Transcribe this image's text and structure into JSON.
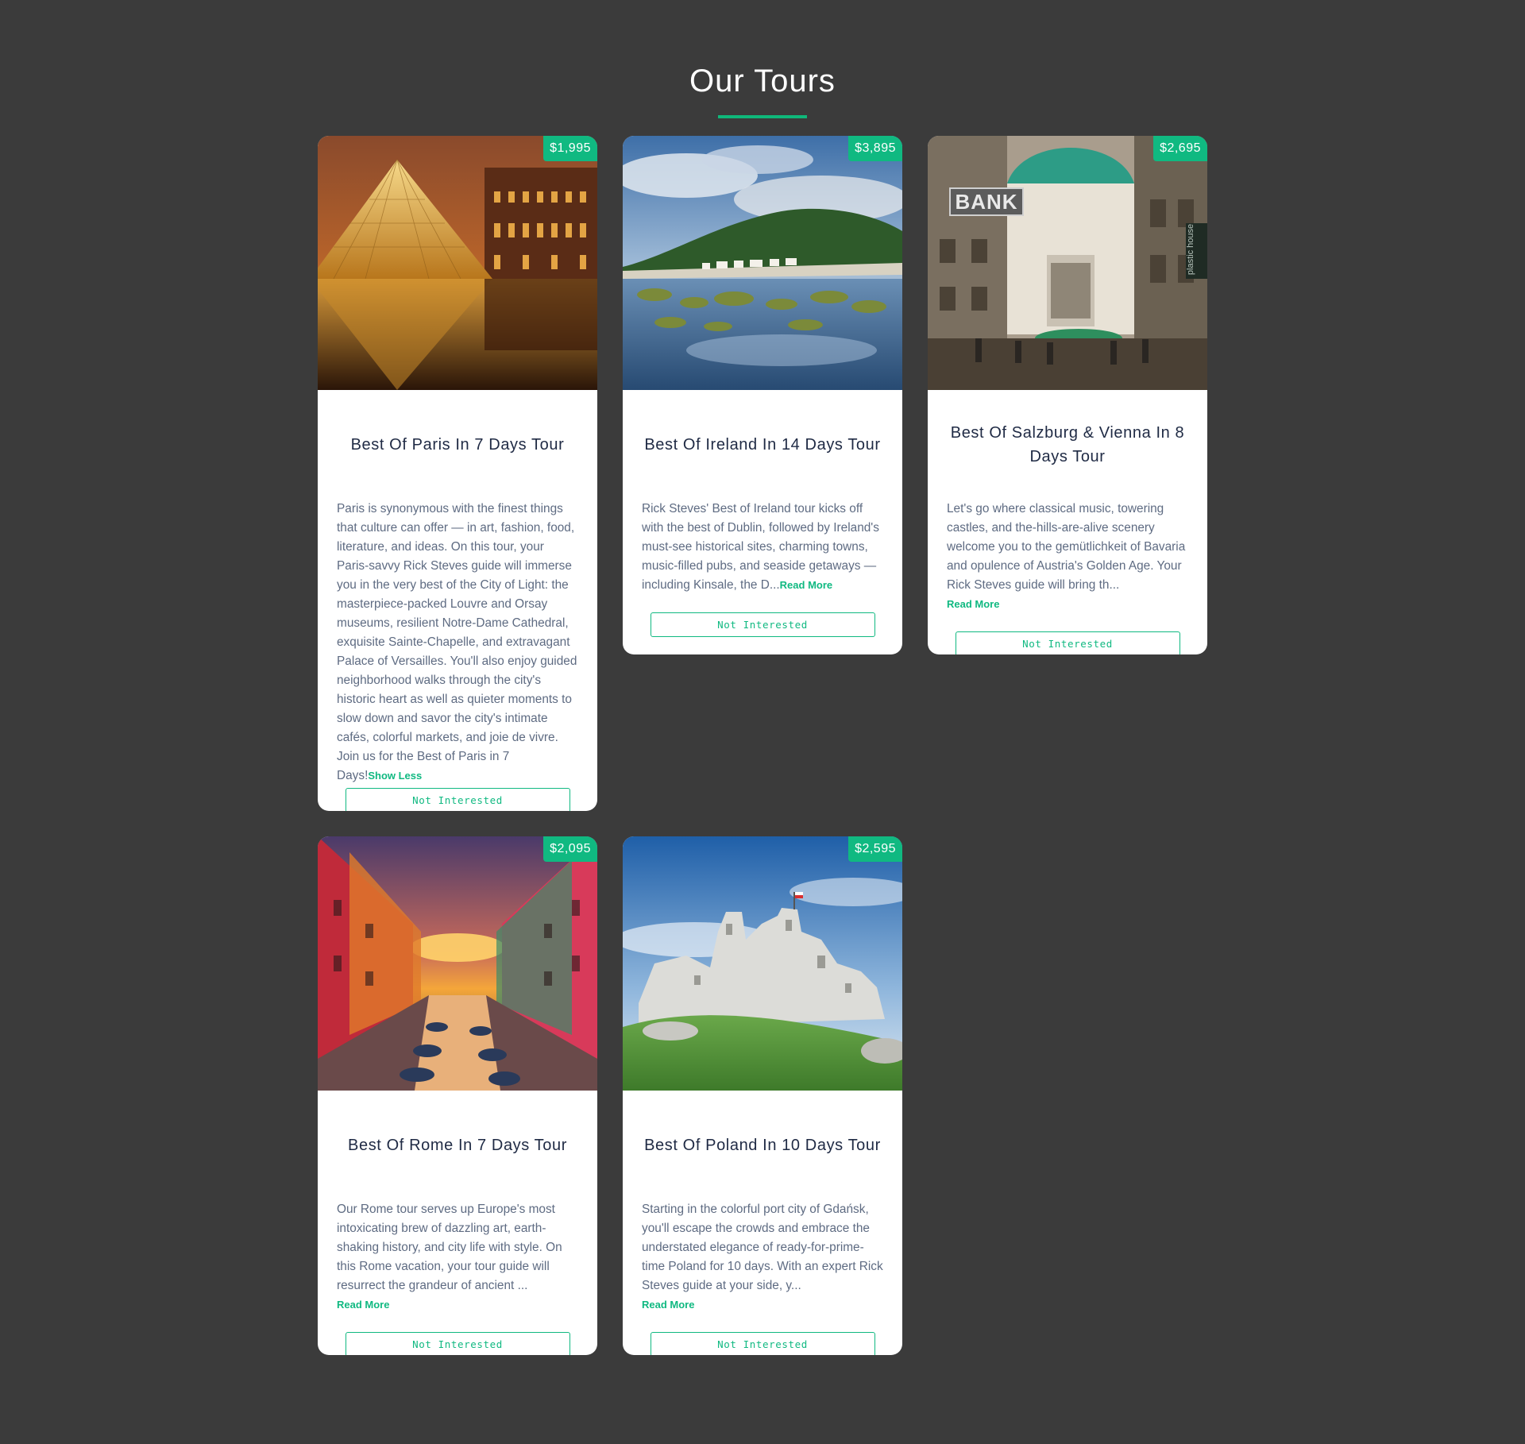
{
  "page": {
    "title": "Our Tours",
    "colors": {
      "background": "#3b3b3b",
      "accent": "#10b981",
      "card": "#ffffff"
    }
  },
  "tours": [
    {
      "price": "$1,995",
      "name": "Best Of Paris In 7 Days Tour",
      "description": "Paris is synonymous with the finest things that culture can offer — in art, fashion, food, literature, and ideas. On this tour, your Paris-savvy Rick Steves guide will immerse you in the very best of the City of Light: the masterpiece-packed Louvre and Orsay museums, resilient Notre-Dame Cathedral, exquisite Sainte-Chapelle, and extravagant Palace of Versailles. You'll also enjoy guided neighborhood walks through the city's historic heart as well as quieter moments to slow down and savor the city's intimate cafés, colorful markets, and joie de vivre. Join us for the Best of Paris in 7 Days!",
      "toggle": "Show Less",
      "button": "Not Interested",
      "image": "louvre-pyramid-photo"
    },
    {
      "price": "$3,895",
      "name": "Best Of Ireland In 14 Days Tour",
      "description": "Rick Steves' Best of Ireland tour kicks off with the best of Dublin, followed by Ireland's must-see historical sites, charming towns, music-filled pubs, and seaside getaways — including Kinsale, the D...",
      "toggle": "Read More",
      "button": "Not Interested",
      "image": "ireland-coast-photo"
    },
    {
      "price": "$2,695",
      "name": "Best Of Salzburg & Vienna In 8 Days Tour",
      "description": "Let's go where classical music, towering castles, and the-hills-are-alive scenery welcome you to the gemütlichkeit of Bavaria and opulence of Austria's Golden Age. Your Rick Steves guide will bring th...",
      "toggle": "Read More",
      "button": "Not Interested",
      "image": "vienna-street-photo",
      "image_signs": {
        "bank": "BANK",
        "side": "plastic house"
      }
    },
    {
      "price": "$2,095",
      "name": "Best Of Rome In 7 Days Tour",
      "description": "Our Rome tour serves up Europe's most intoxicating brew of dazzling art, earth-shaking history, and city life with style. On this Rome vacation, your tour guide will resurrect the grandeur of ancient ...",
      "toggle": "Read More",
      "button": "Not Interested",
      "image": "canal-sunset-photo"
    },
    {
      "price": "$2,595",
      "name": "Best Of Poland In 10 Days Tour",
      "description": "Starting in the colorful port city of Gdańsk, you'll escape the crowds and embrace the understated elegance of ready-for-prime-time Poland for 10 days. With an expert Rick Steves guide at your side, y...",
      "toggle": "Read More",
      "button": "Not Interested",
      "image": "castle-ruins-photo"
    }
  ]
}
